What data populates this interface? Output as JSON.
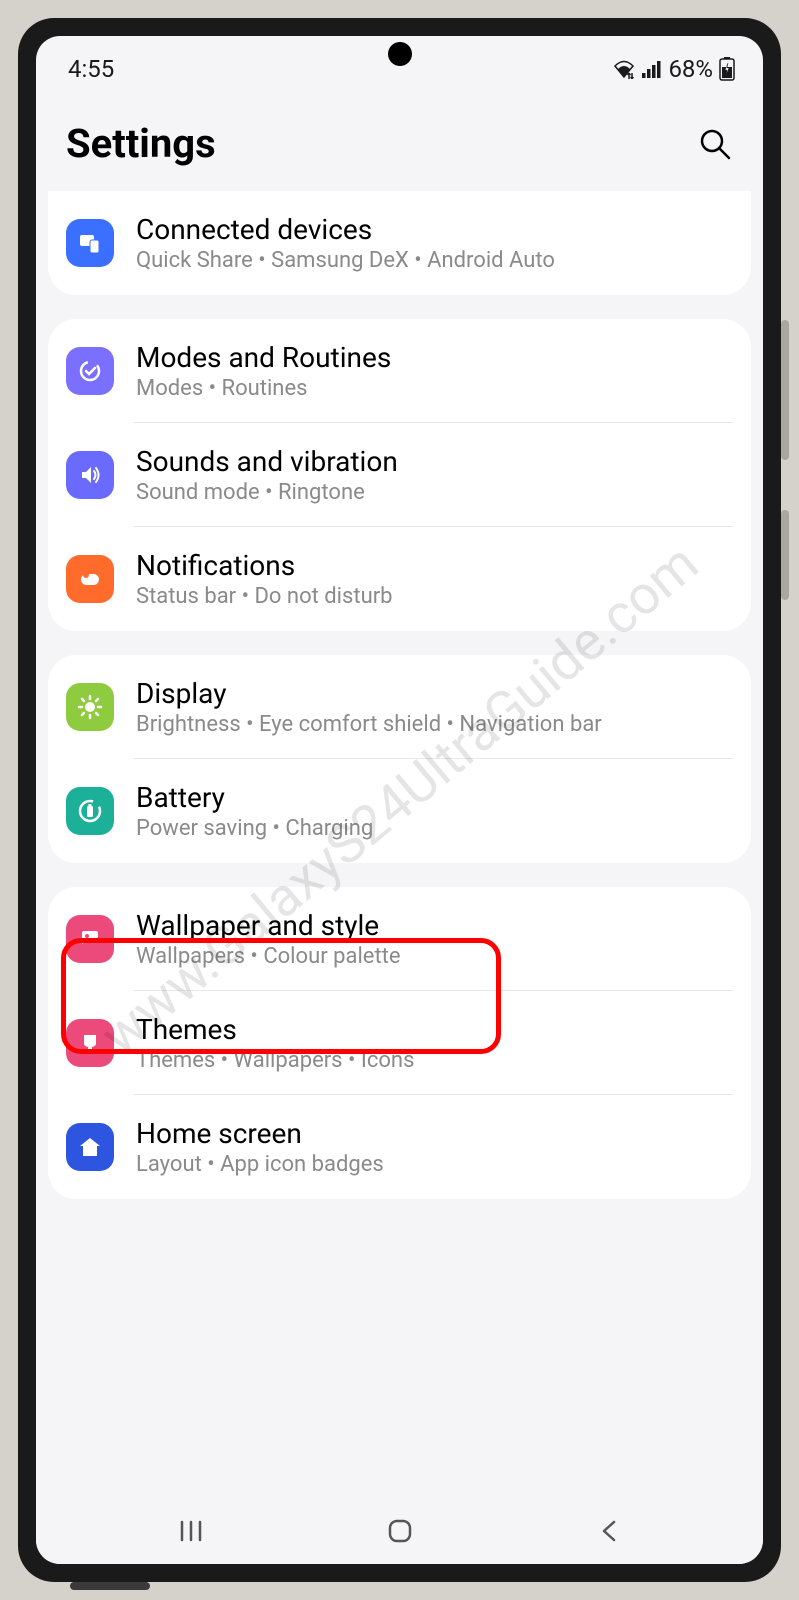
{
  "status": {
    "time": "4:55",
    "battery": "68%"
  },
  "header": {
    "title": "Settings"
  },
  "watermark": "www.GalaxyS24UltraGuide.com",
  "groups": [
    {
      "items": [
        {
          "icon": "devices",
          "color": "blue",
          "title": "Connected devices",
          "sub": "Quick Share  •  Samsung DeX  •  Android Auto"
        }
      ]
    },
    {
      "items": [
        {
          "icon": "modes",
          "color": "purple",
          "title": "Modes and Routines",
          "sub": "Modes  •  Routines"
        },
        {
          "icon": "sound",
          "color": "indigo",
          "title": "Sounds and vibration",
          "sub": "Sound mode  •  Ringtone"
        },
        {
          "icon": "notifications",
          "color": "orange",
          "title": "Notifications",
          "sub": "Status bar  •  Do not disturb"
        }
      ]
    },
    {
      "items": [
        {
          "icon": "display",
          "color": "green",
          "title": "Display",
          "sub": "Brightness  •  Eye comfort shield  •  Navigation bar"
        },
        {
          "icon": "battery",
          "color": "teal",
          "title": "Battery",
          "sub": "Power saving  •  Charging",
          "highlighted": true
        }
      ]
    },
    {
      "items": [
        {
          "icon": "wallpaper",
          "color": "pink",
          "title": "Wallpaper and style",
          "sub": "Wallpapers  •  Colour palette"
        },
        {
          "icon": "themes",
          "color": "pink",
          "title": "Themes",
          "sub": "Themes  •  Wallpapers  •  Icons"
        },
        {
          "icon": "home",
          "color": "navy",
          "title": "Home screen",
          "sub": "Layout  •  App icon badges"
        }
      ]
    }
  ]
}
